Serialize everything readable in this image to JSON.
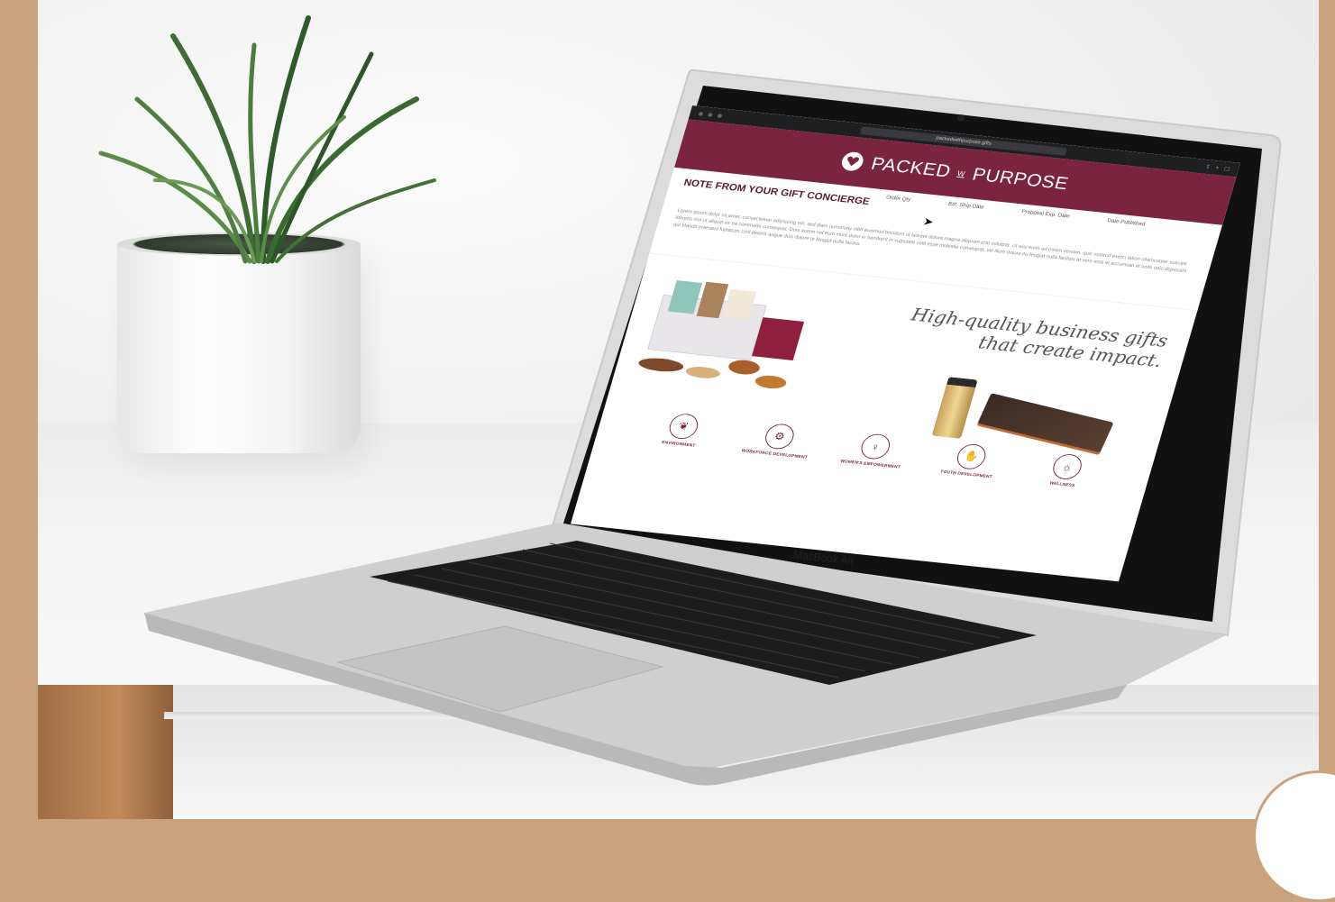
{
  "browser": {
    "url": "packedwithpurpose.gifts"
  },
  "site": {
    "brand_left": "PACKED",
    "brand_mid": "W",
    "brand_right": "PURPOSE",
    "note_title": "NOTE FROM YOUR GIFT CONCIERGE",
    "columns": [
      "Order Qty",
      "Est. Ship Date",
      "Proposal Exp. Date",
      "Date Published"
    ],
    "lorem": "Lorem ipsum dolor sit amet, consectetuer adipiscing elit, sed diam nonummy nibh euismod tincidunt ut laoreet dolore magna aliquam erat volutpat. Ut wisi enim ad minim veniam, quis nostrud exerci tation ullamcorper suscipit lobortis nisl ut aliquip ex ea commodo consequat. Duis autem vel eum iriure dolor in hendrerit in vulputate velit esse molestie consequat, vel illum dolore eu feugiat nulla facilisis at vero eros et accumsan et iusto odio dignissim qui blandit praesent luptatum zzril delenit augue duis dolore te feugait nulla facilisi.",
    "tagline_1": "High-quality business gifts",
    "tagline_2": "that create impact.",
    "categories": [
      "ENVIRONMENT",
      "WORKFORCE DEVELOPMENT",
      "WOMEN'S EMPOWERMENT",
      "YOUTH DEVELOPMENT",
      "WELLNESS"
    ]
  },
  "device": {
    "label": "MacBook Air"
  },
  "colors": {
    "brand": "#7a2440",
    "frame": "#c9a27e"
  }
}
